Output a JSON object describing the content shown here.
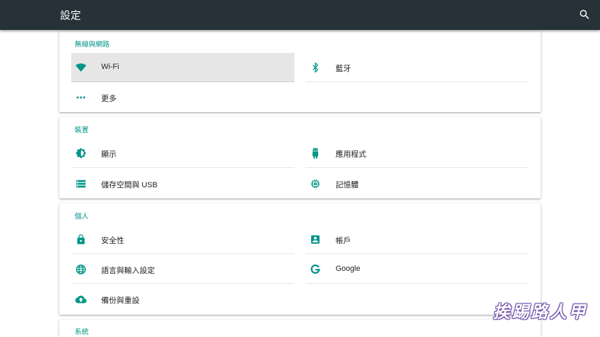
{
  "appbar": {
    "title": "設定",
    "search_icon": "search-icon"
  },
  "colors": {
    "appbar": "#263238",
    "accent": "#009688",
    "selected_row": "#e6e6e6"
  },
  "sections": {
    "network": {
      "title": "無線與網路",
      "wifi": "Wi-Fi",
      "bluetooth": "藍牙",
      "more": "更多"
    },
    "device": {
      "title": "裝置",
      "display": "顯示",
      "apps": "應用程式",
      "storage": "儲存空間與 USB",
      "memory": "記憶體"
    },
    "personal": {
      "title": "個人",
      "security": "安全性",
      "accounts": "帳戶",
      "language": "語言與輸入設定",
      "google": "Google",
      "backup": "備份與重設"
    },
    "system": {
      "title": "系統"
    }
  },
  "watermark": "挨踢路人甲"
}
